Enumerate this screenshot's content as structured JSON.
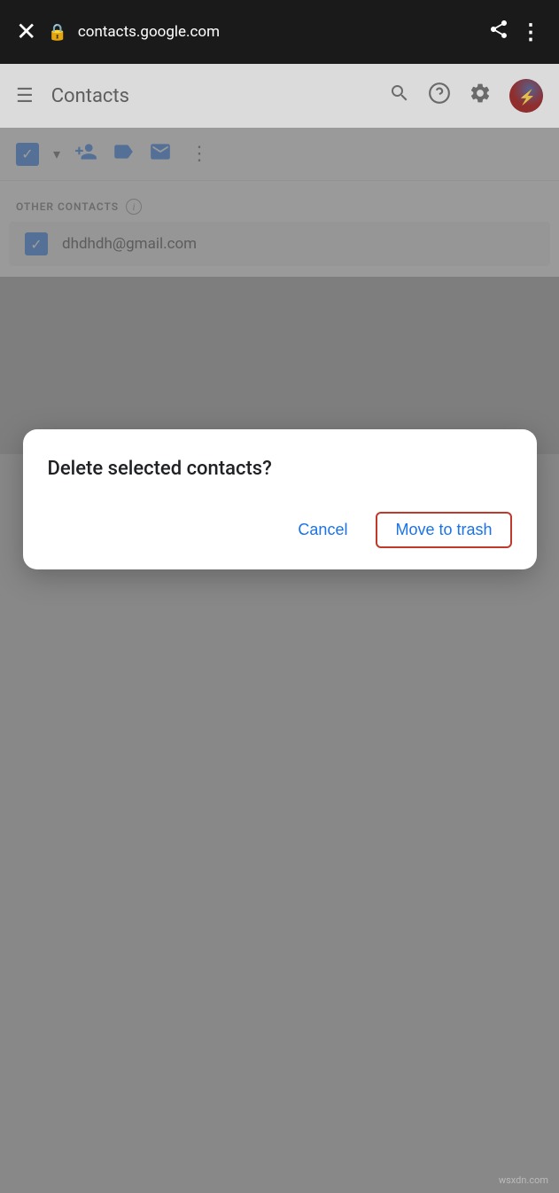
{
  "browser": {
    "url": "contacts.google.com",
    "close_icon": "✕",
    "lock_icon": "🔒",
    "share_icon": "⤴",
    "more_icon": "⋮"
  },
  "header": {
    "hamburger_icon": "☰",
    "title": "Contacts",
    "search_icon": "🔍",
    "help_icon": "?",
    "settings_icon": "⚙"
  },
  "toolbar": {
    "dropdown_icon": "▾",
    "add_contact_icon": "👤+",
    "label_icon": "🏷",
    "email_icon": "✉",
    "more_icon": "⋮"
  },
  "contacts": {
    "section_label": "OTHER CONTACTS",
    "info_icon": "i",
    "email": "dhdhdh@gmail.com"
  },
  "dialog": {
    "title": "Delete selected contacts?",
    "cancel_label": "Cancel",
    "confirm_label": "Move to trash"
  },
  "watermark": "wsxdn.com"
}
